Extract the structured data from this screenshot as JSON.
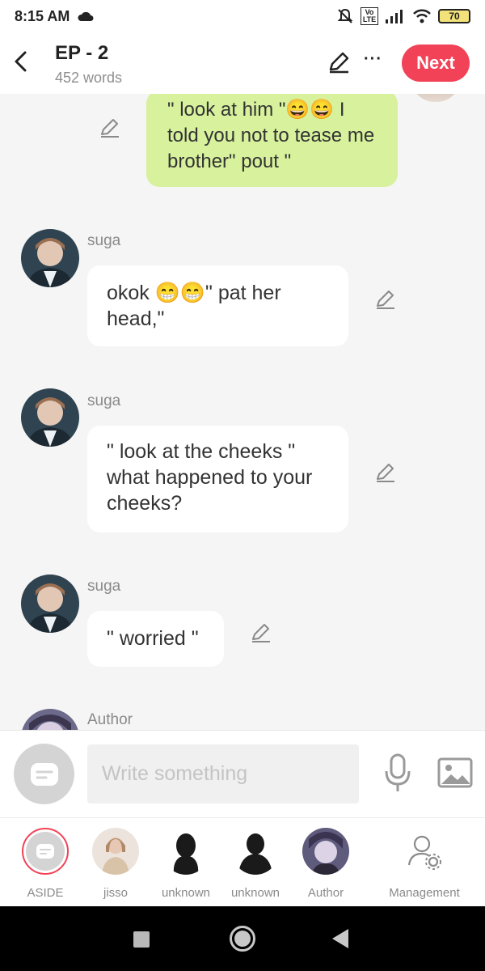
{
  "status_bar": {
    "time": "8:15 AM",
    "network_label": "Vo LTE",
    "battery": "70"
  },
  "header": {
    "title": "EP - 2",
    "word_count": "452 words",
    "next_label": "Next",
    "more_label": "···"
  },
  "messages": {
    "outgoing_top": {
      "text": "\" look at him \"😄😄 I told you not to tease me brother\" pout \""
    },
    "m1": {
      "sender": "suga",
      "text": "okok 😁😁\" pat her head,\""
    },
    "m2": {
      "sender": "suga",
      "text": "\" look at the cheeks \" what happened to your cheeks?"
    },
    "m3": {
      "sender": "suga",
      "text": "\" worried \""
    },
    "m4": {
      "sender": "Author"
    }
  },
  "input": {
    "placeholder": "Write something",
    "value": ""
  },
  "characters": [
    {
      "label": "ASIDE",
      "selected": true
    },
    {
      "label": "jisso"
    },
    {
      "label": "unknown"
    },
    {
      "label": "unknown"
    },
    {
      "label": "Author"
    }
  ],
  "management_label": "Management",
  "colors": {
    "accent": "#f24257",
    "outgoing_bubble": "#d7f19c",
    "background": "#f5f5f5"
  },
  "icons": [
    "back-icon",
    "pencil-icon",
    "more-icon",
    "microphone-icon",
    "image-icon",
    "management-icon",
    "cloud-icon"
  ]
}
